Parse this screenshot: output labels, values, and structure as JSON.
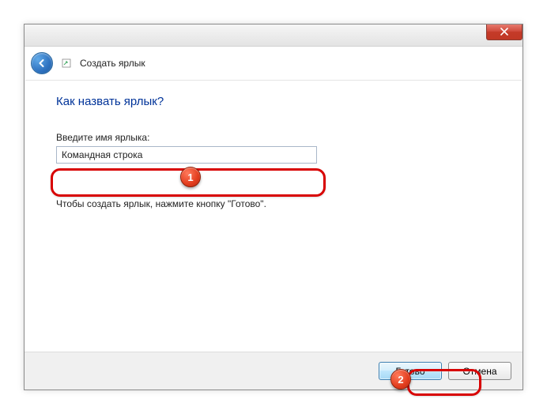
{
  "window": {
    "wizard_label": "Создать ярлык"
  },
  "content": {
    "heading": "Как назвать ярлык?",
    "field_label": "Введите имя ярлыка:",
    "name_value": "Командная строка",
    "instruction": "Чтобы создать ярлык, нажмите кнопку \"Готово\"."
  },
  "footer": {
    "finish": "Готово",
    "cancel": "Отмена"
  },
  "annotations": {
    "marker1": "1",
    "marker2": "2"
  }
}
